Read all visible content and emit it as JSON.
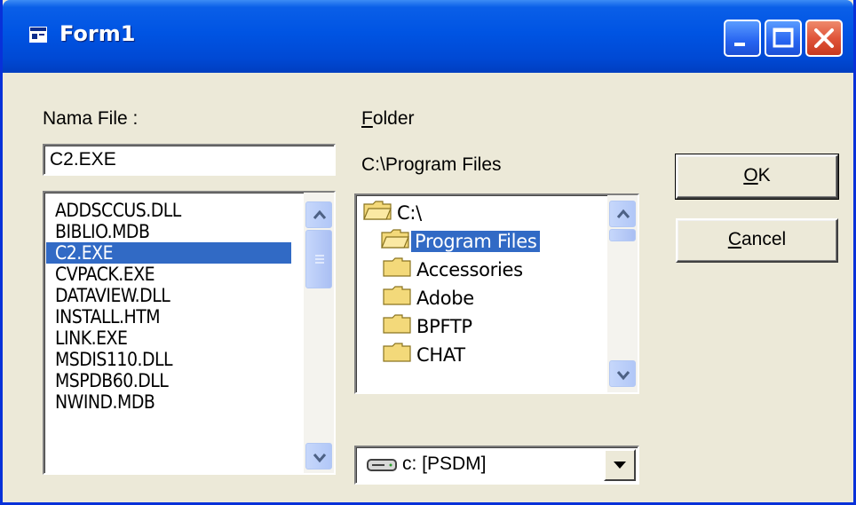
{
  "window": {
    "title": "Form1"
  },
  "labels": {
    "nama_file": "Nama File :",
    "folder_prefix": "F",
    "folder_rest": "older"
  },
  "filename_value": "C2.EXE",
  "current_path": "C:\\Program Files",
  "files": [
    "ADDSCCUS.DLL",
    "BIBLIO.MDB",
    "C2.EXE",
    "CVPACK.EXE",
    "DATAVIEW.DLL",
    "INSTALL.HTM",
    "LINK.EXE",
    "MSDIS110.DLL",
    "MSPDB60.DLL",
    "NWIND.MDB"
  ],
  "selected_file": "C2.EXE",
  "directories": [
    "C:\\",
    "Program Files",
    "Accessories",
    "Adobe",
    "BPFTP",
    "CHAT"
  ],
  "selected_directory": "Program Files",
  "drive": "c: [PSDM]",
  "buttons": {
    "ok_mnemonic": "O",
    "ok_rest": "K",
    "cancel_mnemonic": "C",
    "cancel_rest": "ancel"
  },
  "icons": {
    "title": "form-window-icon",
    "folder": "folder-icon",
    "drive": "hard-drive-icon",
    "scroll_up": "scroll-up-arrow-icon",
    "scroll_down": "scroll-down-arrow-icon",
    "dropdown": "dropdown-arrow-icon"
  },
  "colors": {
    "selection": "#316ac5",
    "face": "#ece9d8",
    "titlebar": "#0054e3",
    "close": "#e0553a"
  }
}
